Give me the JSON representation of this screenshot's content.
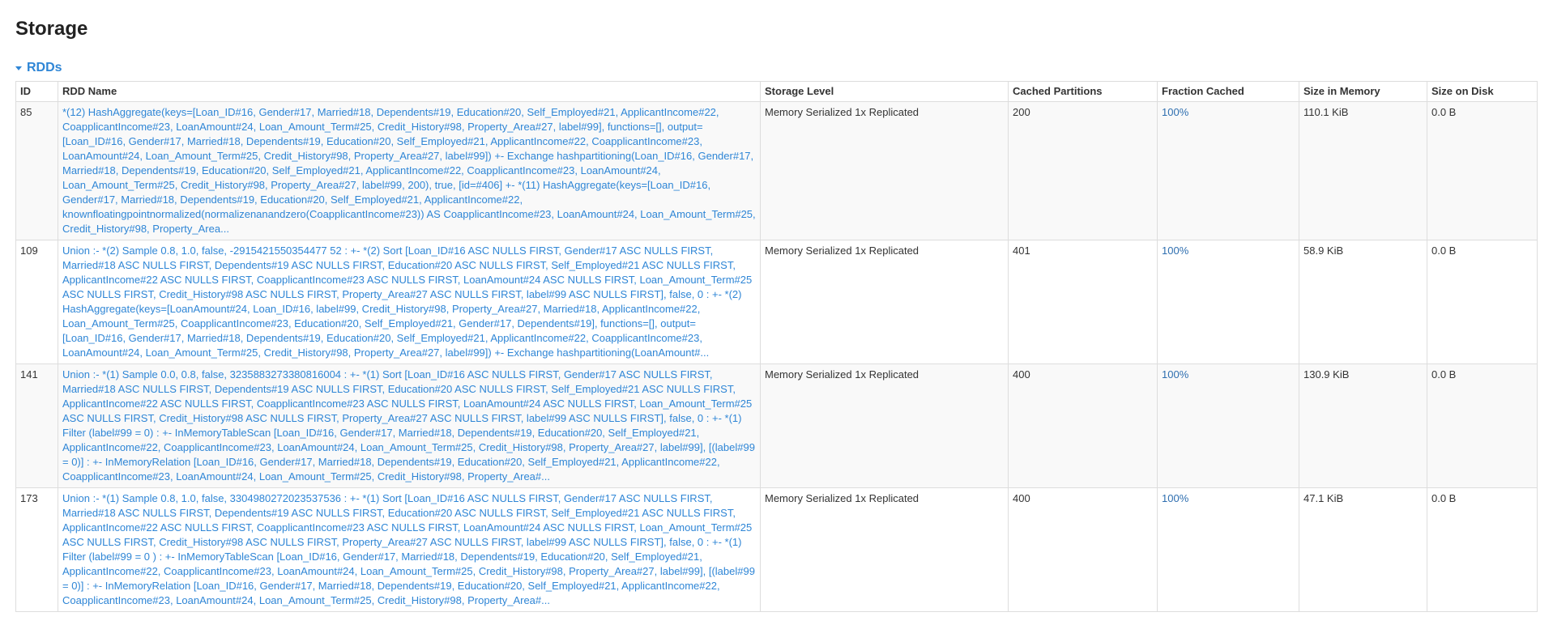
{
  "page_title": "Storage",
  "section": {
    "label": "RDDs",
    "icon": "caret-down-icon",
    "accent": "#2f86d6"
  },
  "table": {
    "headers": [
      "ID",
      "RDD Name",
      "Storage Level",
      "Cached Partitions",
      "Fraction Cached",
      "Size in Memory",
      "Size on Disk"
    ],
    "rows": [
      {
        "id": "85",
        "name": "*(12) HashAggregate(keys=[Loan_ID#16, Gender#17, Married#18, Dependents#19, Education#20, Self_Employed#21, ApplicantIncome#22, CoapplicantIncome#23, LoanAmount#24, Loan_Amount_Term#25, Credit_History#98, Property_Area#27, label#99], functions=[], output=[Loan_ID#16, Gender#17, Married#18, Dependents#19, Education#20, Self_Employed#21, ApplicantIncome#22, CoapplicantIncome#23, LoanAmount#24, Loan_Amount_Term#25, Credit_History#98, Property_Area#27, label#99]) +- Exchange hashpartitioning(Loan_ID#16, Gender#17, Married#18, Dependents#19, Education#20, Self_Employed#21, ApplicantIncome#22, CoapplicantIncome#23, LoanAmount#24, Loan_Amount_Term#25, Credit_History#98, Property_Area#27, label#99, 200), true, [id=#406] +- *(11) HashAggregate(keys=[Loan_ID#16, Gender#17, Married#18, Dependents#19, Education#20, Self_Employed#21, ApplicantIncome#22, knownfloatingpointnormalized(normalizenanandzero(CoapplicantIncome#23)) AS CoapplicantIncome#23, LoanAmount#24, Loan_Amount_Term#25, Credit_History#98, Property_Area...",
        "storage_level": "Memory Serialized 1x Replicated",
        "cached_partitions": "200",
        "fraction_cached": "100%",
        "size_in_memory": "110.1 KiB",
        "size_on_disk": "0.0 B"
      },
      {
        "id": "109",
        "name": "Union :- *(2) Sample 0.8, 1.0, false, -2915421550354477 52 : +- *(2) Sort [Loan_ID#16 ASC NULLS FIRST, Gender#17 ASC NULLS FIRST, Married#18 ASC NULLS FIRST, Dependents#19 ASC NULLS FIRST, Education#20 ASC NULLS FIRST, Self_Employed#21 ASC NULLS FIRST, ApplicantIncome#22 ASC NULLS FIRST, CoapplicantIncome#23 ASC NULLS FIRST, LoanAmount#24 ASC NULLS FIRST, Loan_Amount_Term#25 ASC NULLS FIRST, Credit_History#98 ASC NULLS FIRST, Property_Area#27 ASC NULLS FIRST, label#99 ASC NULLS FIRST], false, 0 : +- *(2) HashAggregate(keys=[LoanAmount#24, Loan_ID#16, label#99, Credit_History#98, Property_Area#27, Married#18, ApplicantIncome#22, Loan_Amount_Term#25, CoapplicantIncome#23, Education#20, Self_Employed#21, Gender#17, Dependents#19], functions=[], output=[Loan_ID#16, Gender#17, Married#18, Dependents#19, Education#20, Self_Employed#21, ApplicantIncome#22, CoapplicantIncome#23, LoanAmount#24, Loan_Amount_Term#25, Credit_History#98, Property_Area#27, label#99]) +- Exchange hashpartitioning(LoanAmount#...",
        "storage_level": "Memory Serialized 1x Replicated",
        "cached_partitions": "401",
        "fraction_cached": "100%",
        "size_in_memory": "58.9 KiB",
        "size_on_disk": "0.0 B"
      },
      {
        "id": "141",
        "name": "Union :- *(1) Sample 0.0, 0.8, false, 3235883273380816004 : +- *(1) Sort [Loan_ID#16 ASC NULLS FIRST, Gender#17 ASC NULLS FIRST, Married#18 ASC NULLS FIRST, Dependents#19 ASC NULLS FIRST, Education#20 ASC NULLS FIRST, Self_Employed#21 ASC NULLS FIRST, ApplicantIncome#22 ASC NULLS FIRST, CoapplicantIncome#23 ASC NULLS FIRST, LoanAmount#24 ASC NULLS FIRST, Loan_Amount_Term#25 ASC NULLS FIRST, Credit_History#98 ASC NULLS FIRST, Property_Area#27 ASC NULLS FIRST, label#99 ASC NULLS FIRST], false, 0 : +- *(1) Filter (label#99 = 0) : +- InMemoryTableScan [Loan_ID#16, Gender#17, Married#18, Dependents#19, Education#20, Self_Employed#21, ApplicantIncome#22, CoapplicantIncome#23, LoanAmount#24, Loan_Amount_Term#25, Credit_History#98, Property_Area#27, label#99], [(label#99 = 0)] : +- InMemoryRelation [Loan_ID#16, Gender#17, Married#18, Dependents#19, Education#20, Self_Employed#21, ApplicantIncome#22, CoapplicantIncome#23, LoanAmount#24, Loan_Amount_Term#25, Credit_History#98, Property_Area#...",
        "storage_level": "Memory Serialized 1x Replicated",
        "cached_partitions": "400",
        "fraction_cached": "100%",
        "size_in_memory": "130.9 KiB",
        "size_on_disk": "0.0 B"
      },
      {
        "id": "173",
        "name": "Union :- *(1) Sample 0.8, 1.0, false, 3304980272023537536 : +- *(1) Sort [Loan_ID#16 ASC NULLS FIRST, Gender#17 ASC NULLS FIRST, Married#18 ASC NULLS FIRST, Dependents#19 ASC NULLS FIRST, Education#20 ASC NULLS FIRST, Self_Employed#21 ASC NULLS FIRST, ApplicantIncome#22 ASC NULLS FIRST, CoapplicantIncome#23 ASC NULLS FIRST, LoanAmount#24 ASC NULLS FIRST, Loan_Amount_Term#25 ASC NULLS FIRST, Credit_History#98 ASC NULLS FIRST, Property_Area#27 ASC NULLS FIRST, label#99 ASC NULLS FIRST], false, 0 : +- *(1) Filter (label#99 = 0 ) : +- InMemoryTableScan [Loan_ID#16, Gender#17, Married#18, Dependents#19, Education#20, Self_Employed#21, ApplicantIncome#22, CoapplicantIncome#23, LoanAmount#24, Loan_Amount_Term#25, Credit_History#98, Property_Area#27, label#99], [(label#99 = 0)] : +- InMemoryRelation [Loan_ID#16, Gender#17, Married#18, Dependents#19, Education#20, Self_Employed#21, ApplicantIncome#22, CoapplicantIncome#23, LoanAmount#24, Loan_Amount_Term#25, Credit_History#98, Property_Area#...",
        "storage_level": "Memory Serialized 1x Replicated",
        "cached_partitions": "400",
        "fraction_cached": "100%",
        "size_in_memory": "47.1 KiB",
        "size_on_disk": "0.0 B"
      }
    ]
  }
}
